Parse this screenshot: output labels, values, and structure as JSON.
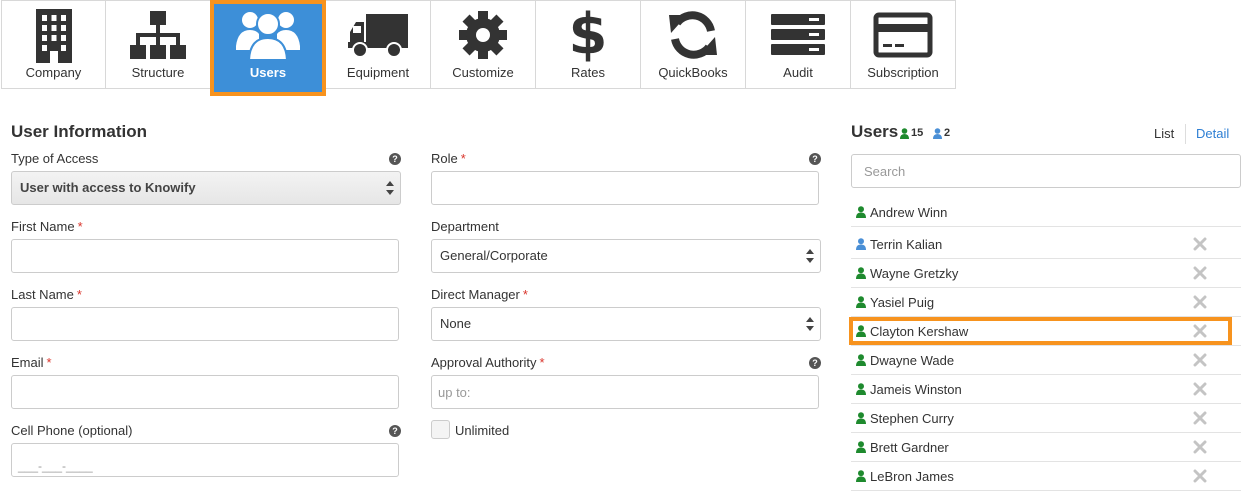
{
  "nav": {
    "items": [
      {
        "label": "Company",
        "icon": "building-icon"
      },
      {
        "label": "Structure",
        "icon": "org-chart-icon"
      },
      {
        "label": "Users",
        "icon": "users-icon"
      },
      {
        "label": "Equipment",
        "icon": "truck-icon"
      },
      {
        "label": "Customize",
        "icon": "gear-icon"
      },
      {
        "label": "Rates",
        "icon": "dollar-icon"
      },
      {
        "label": "QuickBooks",
        "icon": "sync-icon"
      },
      {
        "label": "Audit",
        "icon": "list-icon"
      },
      {
        "label": "Subscription",
        "icon": "credit-card-icon"
      }
    ],
    "active": "Users",
    "active_color": "#3d8fd8",
    "highlight_color": "#f7931e"
  },
  "form": {
    "title": "User Information",
    "type_of_access": {
      "label": "Type of Access",
      "value": "User with access to Knowify"
    },
    "first_name": {
      "label": "First Name",
      "required": "*",
      "value": ""
    },
    "last_name": {
      "label": "Last Name",
      "required": "*",
      "value": ""
    },
    "email": {
      "label": "Email",
      "required": "*",
      "value": ""
    },
    "cell_phone": {
      "label": "Cell Phone (optional)",
      "mask": "___-___-____"
    },
    "role": {
      "label": "Role",
      "required": "*",
      "value": ""
    },
    "department": {
      "label": "Department",
      "value": "General/Corporate"
    },
    "direct_manager": {
      "label": "Direct Manager",
      "required": "*",
      "value": "None"
    },
    "approval_authority": {
      "label": "Approval Authority",
      "required": "*",
      "placeholder": "up to:"
    },
    "unlimited": {
      "label": "Unlimited",
      "checked": false
    },
    "help_glyph": "?"
  },
  "users": {
    "title": "Users",
    "active_count": "15",
    "other_count": "2",
    "view_list": "List",
    "view_detail": "Detail",
    "search_placeholder": "Search",
    "active_color": "#1e8a2e",
    "other_color": "#4a8fd6",
    "list": [
      {
        "name": "Andrew Winn",
        "type": "active",
        "deletable": false
      },
      {
        "name": "Terrin Kalian",
        "type": "other",
        "deletable": true
      },
      {
        "name": "Wayne Gretzky",
        "type": "active",
        "deletable": true
      },
      {
        "name": "Yasiel Puig",
        "type": "active",
        "deletable": true
      },
      {
        "name": "Clayton Kershaw",
        "type": "active",
        "deletable": true,
        "highlighted": true
      },
      {
        "name": "Dwayne Wade",
        "type": "active",
        "deletable": true
      },
      {
        "name": "Jameis Winston",
        "type": "active",
        "deletable": true
      },
      {
        "name": "Stephen Curry",
        "type": "active",
        "deletable": true
      },
      {
        "name": "Brett Gardner",
        "type": "active",
        "deletable": true
      },
      {
        "name": "LeBron James",
        "type": "active",
        "deletable": true
      }
    ]
  }
}
